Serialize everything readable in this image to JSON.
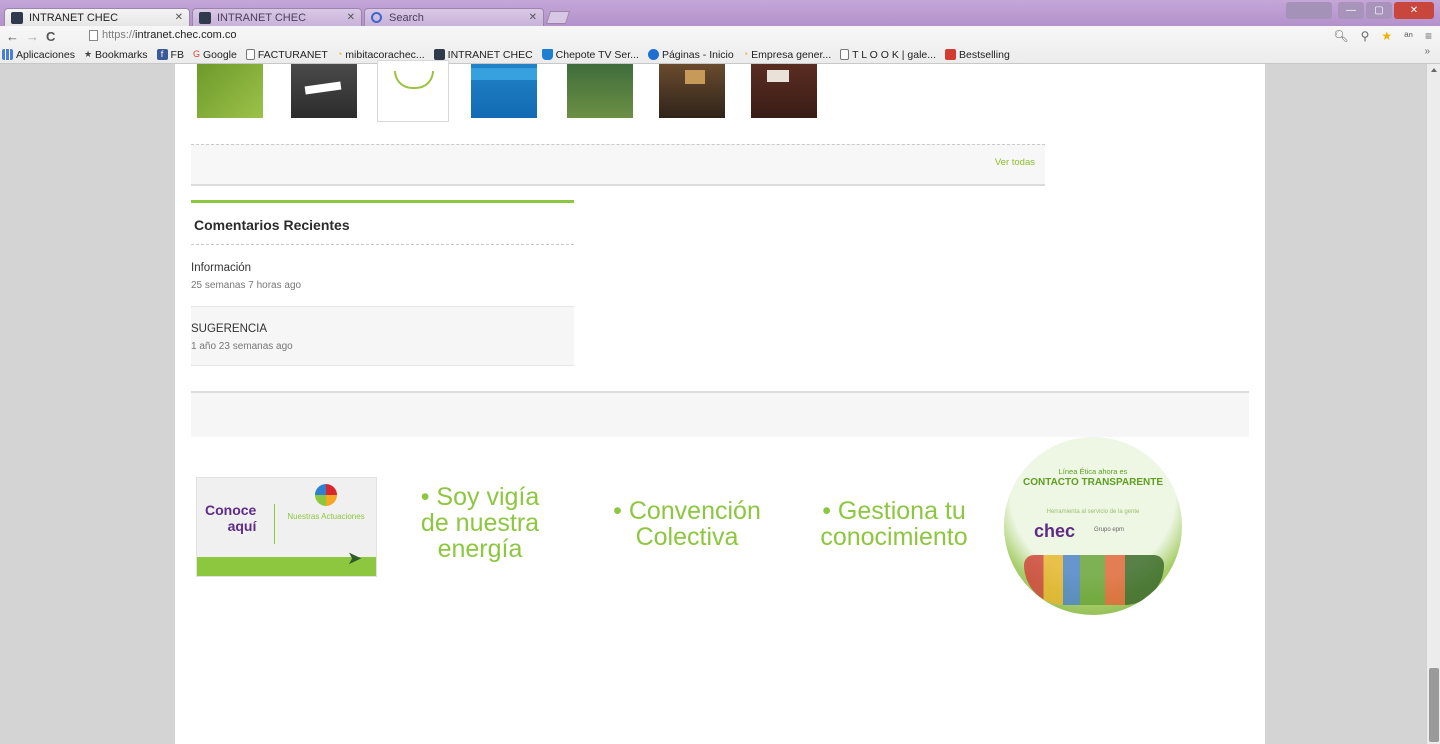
{
  "browser": {
    "tabs": [
      {
        "label": "INTRANET CHEC",
        "active": true
      },
      {
        "label": "INTRANET CHEC",
        "active": false
      },
      {
        "label": "Search",
        "active": false
      }
    ],
    "url_scheme": "https://",
    "url_host": "intranet.chec.com.co",
    "bookmarks": [
      {
        "label": "Aplicaciones",
        "icon": "apps-icon"
      },
      {
        "label": "Bookmarks",
        "icon": "star-icon"
      },
      {
        "label": "FB",
        "icon": "facebook-icon"
      },
      {
        "label": "Google",
        "icon": "google-icon"
      },
      {
        "label": "FACTURANET",
        "icon": "page-icon"
      },
      {
        "label": "mibitacorachec...",
        "icon": "bitacora-icon"
      },
      {
        "label": "INTRANET CHEC",
        "icon": "chec-icon"
      },
      {
        "label": "Chepote TV Ser...",
        "icon": "tv-icon"
      },
      {
        "label": "Páginas - Inicio",
        "icon": "sharepoint-icon"
      },
      {
        "label": "Empresa gener...",
        "icon": "bitacora-icon"
      },
      {
        "label": "T L O O K | gale...",
        "icon": "page-icon"
      },
      {
        "label": "Bestselling",
        "icon": "red-icon"
      }
    ]
  },
  "page": {
    "ver_todas": "Ver todas",
    "comments": {
      "heading": "Comentarios Recientes",
      "items": [
        {
          "title": "Información",
          "meta": "25 semanas 7 horas ago"
        },
        {
          "title": "SUGERENCIA",
          "meta": "1 año 23 semanas ago"
        }
      ]
    },
    "banners": {
      "conoce_line1": "Conoce",
      "conoce_line2": "aquí",
      "conoce_sub": "Nuestras Actuaciones",
      "slogan1": "• Soy vigía de nuestra energía",
      "slogan2": "• Convención Colectiva",
      "slogan3": "• Gestiona tu conocimiento",
      "circle_line1": "Línea Ética ahora es",
      "circle_line2": "CONTACTO TRANSPARENTE",
      "circle_line3": "Herramienta al servicio de la gente",
      "circle_brand": "chec",
      "circle_group": "Grupo epm"
    }
  }
}
